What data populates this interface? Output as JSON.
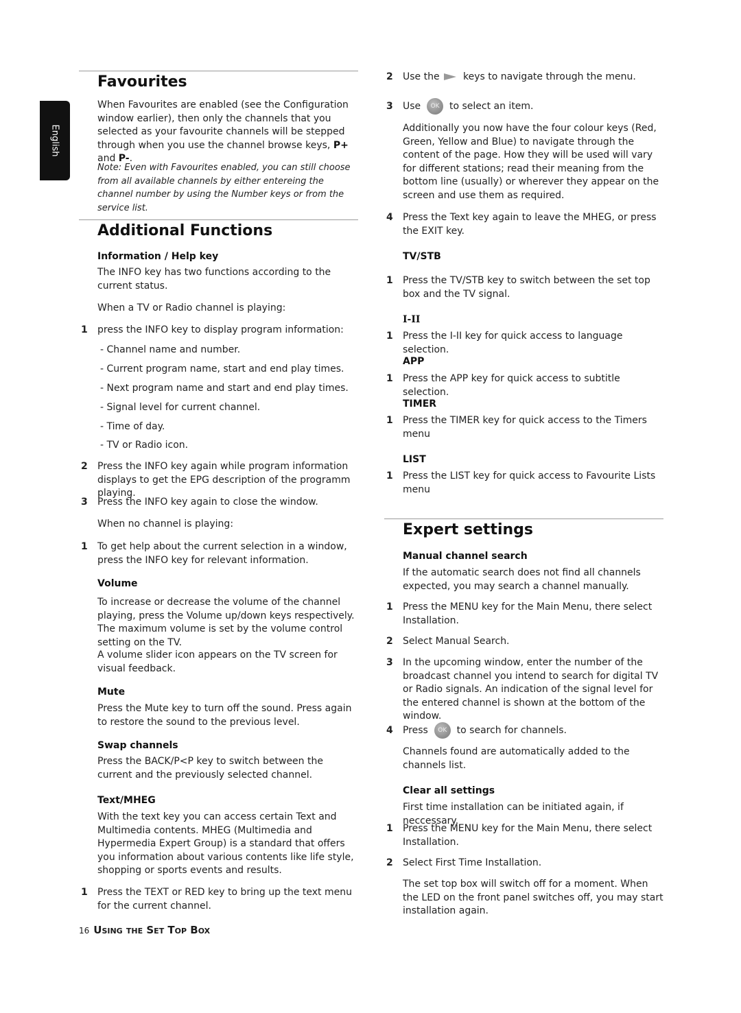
{
  "language_tab": "English",
  "left": {
    "favourites": {
      "title": "Favourites",
      "body_pre": "When Favourites are enabled (see the Configuration window earlier), then only the channels that you selected as your favourite channels will be stepped through when you use the channel browse keys, ",
      "key1": "P+",
      "and": " and ",
      "key2": "P-",
      "end": ".",
      "note": "Note:  Even with Favourites enabled, you can still choose from all available channels by either entereing the channel number by using the Number keys or from the service list."
    },
    "additional": {
      "title": "Additional Functions",
      "info_heading": "Information / Help key",
      "info_intro": "The INFO key has two functions according to the current status.",
      "playing": "When a TV or Radio channel is playing:",
      "step1": "press the INFO key to display program information:",
      "bullets": [
        "- Channel name and number.",
        "- Current program name, start and end play times.",
        "- Next program name and start and end play times.",
        "- Signal level for current channel.",
        "- Time of day.",
        "- TV or Radio icon."
      ],
      "step2": "Press the INFO key again while program information displays to get the EPG description of the programm playing.",
      "step3": "Press the INFO key again to close the window.",
      "no_channel": "When no channel is playing:",
      "step_help": "To get help about the current selection in a window, press the INFO key for relevant information.",
      "volume_heading": "Volume",
      "volume_body": "To increase or decrease the volume of the channel playing, press the Volume up/down keys respectively. The maximum volume is set by the volume control setting on the TV.",
      "volume_body2": "A volume slider icon appears on the TV screen for visual feedback.",
      "mute_heading": "Mute",
      "mute_body": "Press the Mute key to turn off the sound. Press again to restore the sound to the previous level.",
      "swap_heading": "Swap channels",
      "swap_body": "Press the BACK/P<P key to switch between the current and the  previously selected channel.",
      "text_heading": "Text/MHEG",
      "text_body": "With the text key you can access certain Text and Multimedia contents. MHEG (Multimedia and Hypermedia Expert Group) is a standard that offers you information about various contents like life style, shopping or sports events and results.",
      "text_step1": "Press the TEXT or RED key to bring up the text menu for the current channel."
    }
  },
  "right": {
    "step2": "Use the  keys to navigate through the menu.",
    "step3_pre": "Use",
    "step3_post": "to select an item.",
    "ok_label": "OK",
    "colour_keys": "Additionally you now have the four colour keys (Red, Green, Yellow and Blue) to navigate through the content of the page. How they will be used will vary for different stations; read their meaning from the bottom line (usually) or wherever they appear on the screen and use them as required.",
    "step4": "Press the Text key again to leave the MHEG, or press the EXIT key.",
    "tvstb_heading": "TV/STB",
    "tvstb_step": "Press the TV/STB key to switch between the set top box and the TV signal.",
    "iii_heading": "I-II",
    "iii_step": "Press the I-II key for quick access to language selection.",
    "app_heading": "APP",
    "app_step": "Press the APP key for quick access to subtitle selection.",
    "timer_heading": "TIMER",
    "timer_step": "Press the TIMER key for quick access to the Timers menu",
    "list_heading": "LIST",
    "list_step": "Press the LIST key for quick access to Favourite Lists menu",
    "expert": {
      "title": "Expert settings",
      "manual_heading": "Manual channel search",
      "manual_intro": "If the automatic search does not find all channels expected, you may search a channel manually.",
      "m1": "Press the MENU key for the Main Menu, there select Installation.",
      "m2": "Select Manual Search.",
      "m3": "In the upcoming window, enter the number of the broadcast channel you intend to search for digital TV or Radio signals. An indication of the signal level for the entered channel is shown at the bottom of the window.",
      "m4_pre": "Press",
      "m4_post": "to search for channels.",
      "m4_note": "Channels found are automatically added to the channels list.",
      "clear_heading": "Clear all settings",
      "clear_intro": "First time installation can be initiated again, if neccessary.",
      "c1": "Press the MENU key for the Main Menu, there select Installation.",
      "c2": "Select First Time Installation.",
      "c_note": "The set top box will switch off for a moment. When the LED on the front panel switches off, you may start installation again."
    }
  },
  "footer": {
    "page": "16",
    "title": "Using the Set Top Box"
  }
}
